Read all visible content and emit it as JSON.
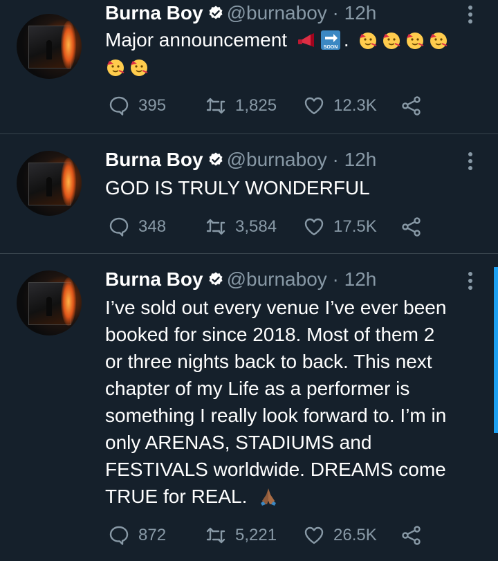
{
  "tweets": [
    {
      "name": "Burna Boy",
      "handle": "@burnaboy",
      "time": "· 12h",
      "text_lines": [
        "Major announcement"
      ],
      "replies": "395",
      "retweets": "1,825",
      "likes": "12.3K"
    },
    {
      "name": "Burna Boy",
      "handle": "@burnaboy",
      "time": "· 12h",
      "text_lines": [
        "GOD IS TRULY WONDERFUL"
      ],
      "replies": "348",
      "retweets": "3,584",
      "likes": "17.5K"
    },
    {
      "name": "Burna Boy",
      "handle": "@burnaboy",
      "time": "· 12h",
      "text_lines": [
        "I’ve sold out every venue I’ve ever been",
        "booked for since 2018. Most of them 2",
        "or three nights back to back. This next",
        "chapter of my Life as a performer is",
        "something I really look forward to. I’m in",
        "only ARENAS, STADIUMS and",
        "FESTIVALS worldwide. DREAMS come",
        "TRUE for REAL."
      ],
      "replies": "872",
      "retweets": "5,221",
      "likes": "26.5K"
    }
  ],
  "emoji": {
    "soon_label": "SOON",
    "period": ".",
    "icons": [
      "megaphone-icon",
      "soon-arrow-icon",
      "partying-face-icon",
      "folded-hands-icon"
    ]
  },
  "colors": {
    "background": "#15202b",
    "muted": "#8899a6",
    "divider": "#38444d",
    "accent": "#1da1f2"
  }
}
